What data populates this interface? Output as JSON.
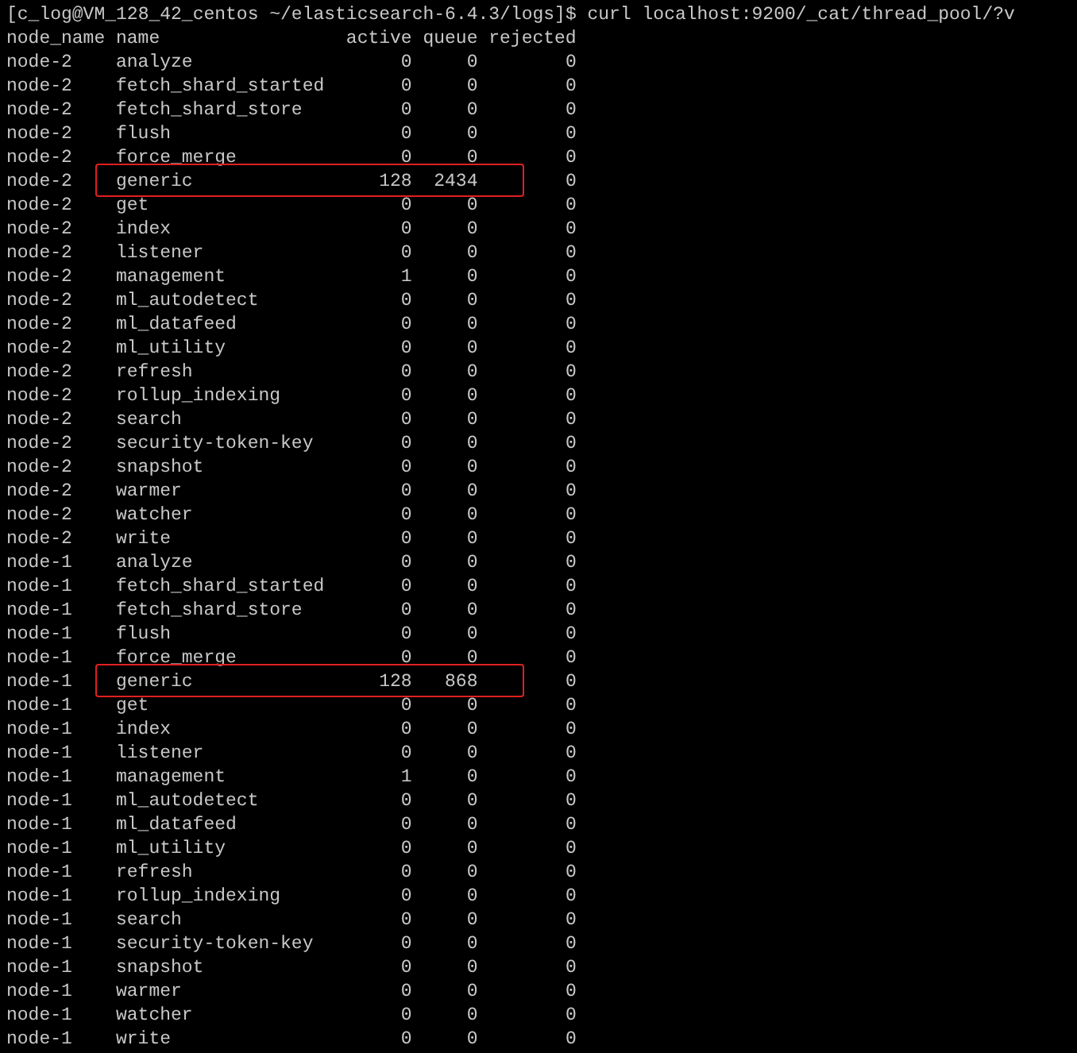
{
  "prompt": {
    "text": "[c_log@VM_128_42_centos ~/elasticsearch-6.4.3/logs]$ curl localhost:9200/_cat/thread_pool/?v"
  },
  "table": {
    "columns": [
      "node_name",
      "name",
      "active",
      "queue",
      "rejected"
    ],
    "rows": [
      {
        "node_name": "node-2",
        "name": "analyze",
        "active": "0",
        "queue": "0",
        "rejected": "0",
        "highlighted": false
      },
      {
        "node_name": "node-2",
        "name": "fetch_shard_started",
        "active": "0",
        "queue": "0",
        "rejected": "0",
        "highlighted": false
      },
      {
        "node_name": "node-2",
        "name": "fetch_shard_store",
        "active": "0",
        "queue": "0",
        "rejected": "0",
        "highlighted": false
      },
      {
        "node_name": "node-2",
        "name": "flush",
        "active": "0",
        "queue": "0",
        "rejected": "0",
        "highlighted": false
      },
      {
        "node_name": "node-2",
        "name": "force_merge",
        "active": "0",
        "queue": "0",
        "rejected": "0",
        "highlighted": false
      },
      {
        "node_name": "node-2",
        "name": "generic",
        "active": "128",
        "queue": "2434",
        "rejected": "0",
        "highlighted": true
      },
      {
        "node_name": "node-2",
        "name": "get",
        "active": "0",
        "queue": "0",
        "rejected": "0",
        "highlighted": false
      },
      {
        "node_name": "node-2",
        "name": "index",
        "active": "0",
        "queue": "0",
        "rejected": "0",
        "highlighted": false
      },
      {
        "node_name": "node-2",
        "name": "listener",
        "active": "0",
        "queue": "0",
        "rejected": "0",
        "highlighted": false
      },
      {
        "node_name": "node-2",
        "name": "management",
        "active": "1",
        "queue": "0",
        "rejected": "0",
        "highlighted": false
      },
      {
        "node_name": "node-2",
        "name": "ml_autodetect",
        "active": "0",
        "queue": "0",
        "rejected": "0",
        "highlighted": false
      },
      {
        "node_name": "node-2",
        "name": "ml_datafeed",
        "active": "0",
        "queue": "0",
        "rejected": "0",
        "highlighted": false
      },
      {
        "node_name": "node-2",
        "name": "ml_utility",
        "active": "0",
        "queue": "0",
        "rejected": "0",
        "highlighted": false
      },
      {
        "node_name": "node-2",
        "name": "refresh",
        "active": "0",
        "queue": "0",
        "rejected": "0",
        "highlighted": false
      },
      {
        "node_name": "node-2",
        "name": "rollup_indexing",
        "active": "0",
        "queue": "0",
        "rejected": "0",
        "highlighted": false
      },
      {
        "node_name": "node-2",
        "name": "search",
        "active": "0",
        "queue": "0",
        "rejected": "0",
        "highlighted": false
      },
      {
        "node_name": "node-2",
        "name": "security-token-key",
        "active": "0",
        "queue": "0",
        "rejected": "0",
        "highlighted": false
      },
      {
        "node_name": "node-2",
        "name": "snapshot",
        "active": "0",
        "queue": "0",
        "rejected": "0",
        "highlighted": false
      },
      {
        "node_name": "node-2",
        "name": "warmer",
        "active": "0",
        "queue": "0",
        "rejected": "0",
        "highlighted": false
      },
      {
        "node_name": "node-2",
        "name": "watcher",
        "active": "0",
        "queue": "0",
        "rejected": "0",
        "highlighted": false
      },
      {
        "node_name": "node-2",
        "name": "write",
        "active": "0",
        "queue": "0",
        "rejected": "0",
        "highlighted": false
      },
      {
        "node_name": "node-1",
        "name": "analyze",
        "active": "0",
        "queue": "0",
        "rejected": "0",
        "highlighted": false
      },
      {
        "node_name": "node-1",
        "name": "fetch_shard_started",
        "active": "0",
        "queue": "0",
        "rejected": "0",
        "highlighted": false
      },
      {
        "node_name": "node-1",
        "name": "fetch_shard_store",
        "active": "0",
        "queue": "0",
        "rejected": "0",
        "highlighted": false
      },
      {
        "node_name": "node-1",
        "name": "flush",
        "active": "0",
        "queue": "0",
        "rejected": "0",
        "highlighted": false
      },
      {
        "node_name": "node-1",
        "name": "force_merge",
        "active": "0",
        "queue": "0",
        "rejected": "0",
        "highlighted": false
      },
      {
        "node_name": "node-1",
        "name": "generic",
        "active": "128",
        "queue": "868",
        "rejected": "0",
        "highlighted": true
      },
      {
        "node_name": "node-1",
        "name": "get",
        "active": "0",
        "queue": "0",
        "rejected": "0",
        "highlighted": false
      },
      {
        "node_name": "node-1",
        "name": "index",
        "active": "0",
        "queue": "0",
        "rejected": "0",
        "highlighted": false
      },
      {
        "node_name": "node-1",
        "name": "listener",
        "active": "0",
        "queue": "0",
        "rejected": "0",
        "highlighted": false
      },
      {
        "node_name": "node-1",
        "name": "management",
        "active": "1",
        "queue": "0",
        "rejected": "0",
        "highlighted": false
      },
      {
        "node_name": "node-1",
        "name": "ml_autodetect",
        "active": "0",
        "queue": "0",
        "rejected": "0",
        "highlighted": false
      },
      {
        "node_name": "node-1",
        "name": "ml_datafeed",
        "active": "0",
        "queue": "0",
        "rejected": "0",
        "highlighted": false
      },
      {
        "node_name": "node-1",
        "name": "ml_utility",
        "active": "0",
        "queue": "0",
        "rejected": "0",
        "highlighted": false
      },
      {
        "node_name": "node-1",
        "name": "refresh",
        "active": "0",
        "queue": "0",
        "rejected": "0",
        "highlighted": false
      },
      {
        "node_name": "node-1",
        "name": "rollup_indexing",
        "active": "0",
        "queue": "0",
        "rejected": "0",
        "highlighted": false
      },
      {
        "node_name": "node-1",
        "name": "search",
        "active": "0",
        "queue": "0",
        "rejected": "0",
        "highlighted": false
      },
      {
        "node_name": "node-1",
        "name": "security-token-key",
        "active": "0",
        "queue": "0",
        "rejected": "0",
        "highlighted": false
      },
      {
        "node_name": "node-1",
        "name": "snapshot",
        "active": "0",
        "queue": "0",
        "rejected": "0",
        "highlighted": false
      },
      {
        "node_name": "node-1",
        "name": "warmer",
        "active": "0",
        "queue": "0",
        "rejected": "0",
        "highlighted": false
      },
      {
        "node_name": "node-1",
        "name": "watcher",
        "active": "0",
        "queue": "0",
        "rejected": "0",
        "highlighted": false
      },
      {
        "node_name": "node-1",
        "name": "write",
        "active": "0",
        "queue": "0",
        "rejected": "0",
        "highlighted": false
      }
    ]
  }
}
